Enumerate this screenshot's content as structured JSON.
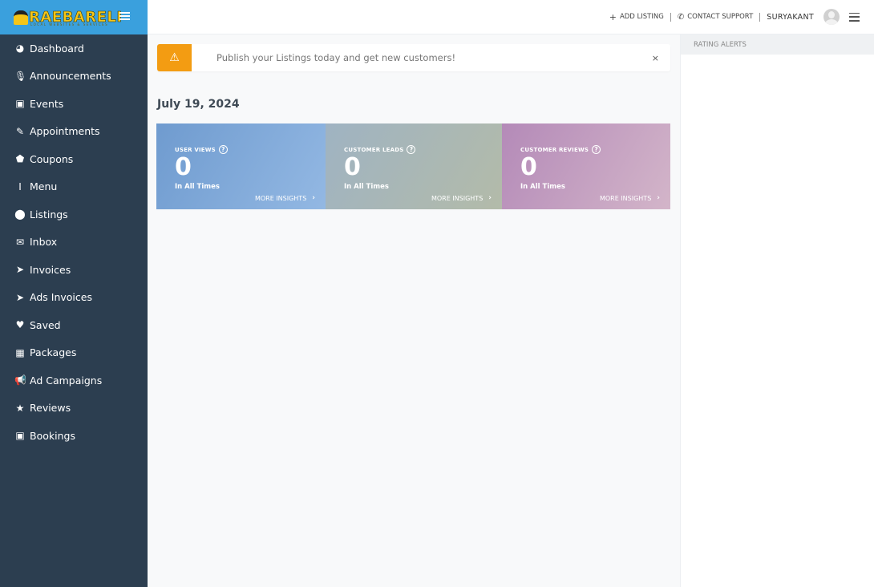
{
  "brand": {
    "name": "RAEBARELI",
    "tagline": "LOCAL WEBSITES & SERVICES",
    "color": "#3aa0dd"
  },
  "sidebar": {
    "items": [
      {
        "label": "Dashboard",
        "icon": "dashboard-icon",
        "glyph": "◕"
      },
      {
        "label": "Announcements",
        "icon": "microphone-icon",
        "glyph": "🎙"
      },
      {
        "label": "Events",
        "icon": "calendar-icon",
        "glyph": "▣"
      },
      {
        "label": "Appointments",
        "icon": "edit-icon",
        "glyph": "✎"
      },
      {
        "label": "Coupons",
        "icon": "tags-icon",
        "glyph": "⬟"
      },
      {
        "label": "Menu",
        "icon": "cutlery-icon",
        "glyph": "ⵏ"
      },
      {
        "label": "Listings",
        "icon": "map-marker-icon",
        "glyph": "⬤"
      },
      {
        "label": "Inbox",
        "icon": "envelope-icon",
        "glyph": "✉"
      },
      {
        "label": "Invoices",
        "icon": "paper-plane-icon",
        "glyph": "➤"
      },
      {
        "label": "Ads Invoices",
        "icon": "paper-plane-icon",
        "glyph": "➤"
      },
      {
        "label": "Saved",
        "icon": "heart-icon",
        "glyph": "♥"
      },
      {
        "label": "Packages",
        "icon": "gift-icon",
        "glyph": "▦"
      },
      {
        "label": "Ad Campaigns",
        "icon": "bullhorn-icon",
        "glyph": "📢"
      },
      {
        "label": "Reviews",
        "icon": "star-icon",
        "glyph": "★"
      },
      {
        "label": "Bookings",
        "icon": "calendar-icon",
        "glyph": "▣"
      }
    ]
  },
  "topbar": {
    "add_listing": "ADD LISTING",
    "add_listing_glyph": "+",
    "contact_support": "CONTACT SUPPORT",
    "contact_glyph": "✆",
    "username": "SURYAKANT"
  },
  "alert": {
    "glyph": "⚠",
    "text": "Publish your Listings today and get new customers!",
    "close": "×",
    "color": "#f39c12"
  },
  "main": {
    "date": "July 19, 2024",
    "cards": [
      {
        "label": "USER VIEWS",
        "help": "?",
        "value": "0",
        "sub": "In All Times",
        "more": "MORE INSIGHTS",
        "chev": "›"
      },
      {
        "label": "CUSTOMER LEADS",
        "help": "?",
        "value": "0",
        "sub": "In All Times",
        "more": "MORE INSIGHTS",
        "chev": "›"
      },
      {
        "label": "CUSTOMER REVIEWS",
        "help": "?",
        "value": "0",
        "sub": "In All Times",
        "more": "MORE INSIGHTS",
        "chev": "›"
      }
    ]
  },
  "right_panel": {
    "title": "RATING ALERTS"
  }
}
